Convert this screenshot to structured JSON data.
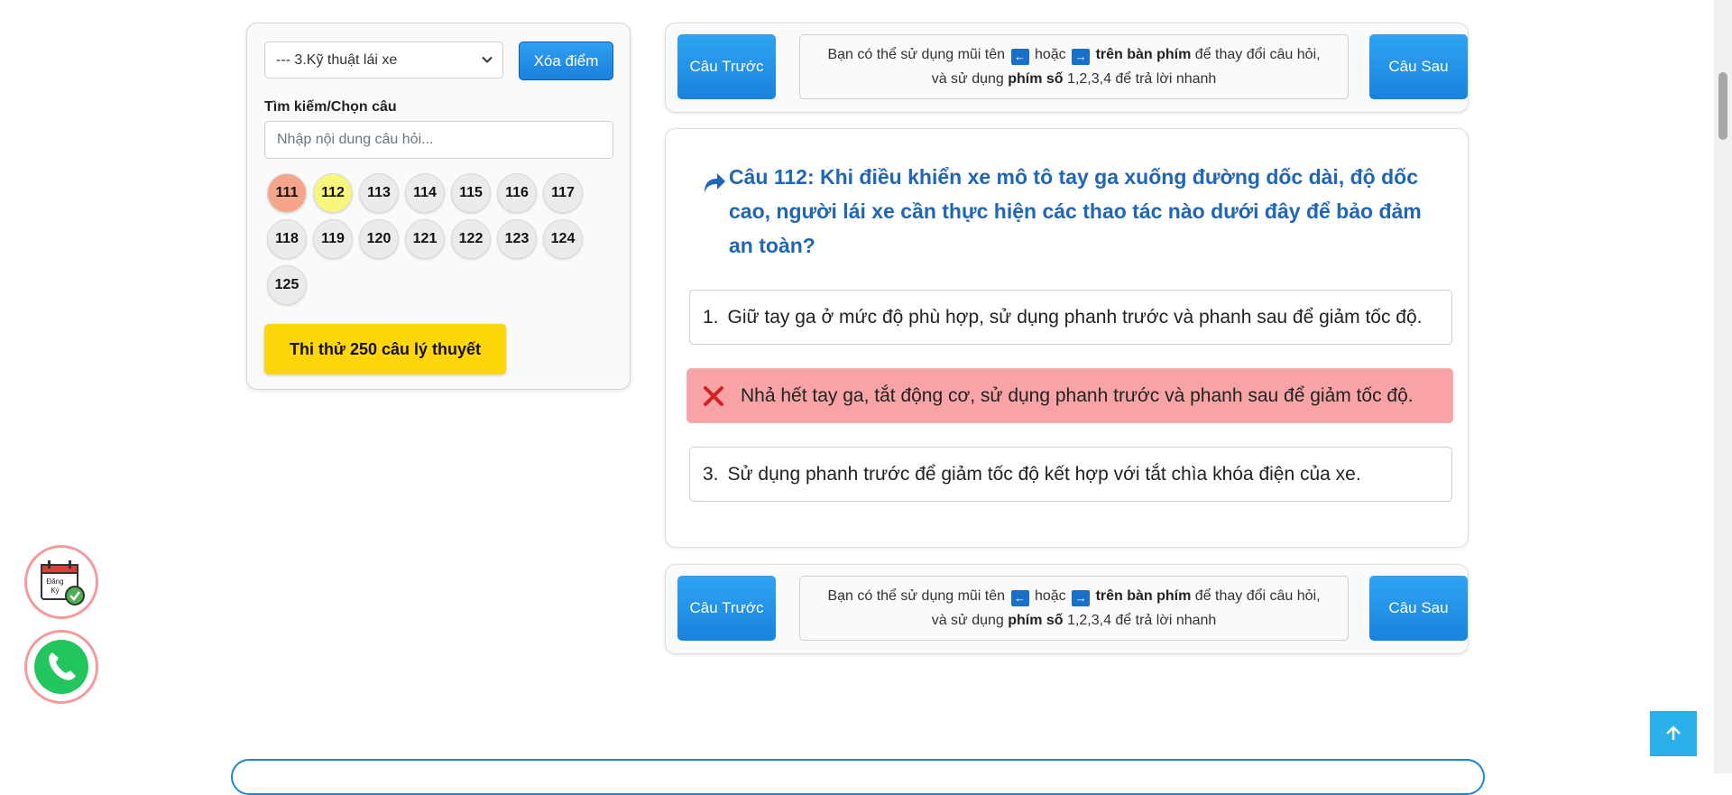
{
  "sidebar": {
    "chapter_select": "--- 3.Kỹ thuật lái xe",
    "clear_button": "Xóa điểm",
    "search_label": "Tìm kiếm/Chọn câu",
    "search_placeholder": "Nhập nội dung câu hỏi...",
    "questions": [
      {
        "n": "111",
        "state": "wrong"
      },
      {
        "n": "112",
        "state": "current"
      },
      {
        "n": "113",
        "state": "default"
      },
      {
        "n": "114",
        "state": "default"
      },
      {
        "n": "115",
        "state": "default"
      },
      {
        "n": "116",
        "state": "default"
      },
      {
        "n": "117",
        "state": "default"
      },
      {
        "n": "118",
        "state": "default"
      },
      {
        "n": "119",
        "state": "default"
      },
      {
        "n": "120",
        "state": "default"
      },
      {
        "n": "121",
        "state": "default"
      },
      {
        "n": "122",
        "state": "default"
      },
      {
        "n": "123",
        "state": "default"
      },
      {
        "n": "124",
        "state": "default"
      },
      {
        "n": "125",
        "state": "default"
      }
    ],
    "exam_button": "Thi thử 250 câu lý thuyết"
  },
  "nav": {
    "prev_label": "Câu Trước",
    "next_label": "Câu Sau",
    "hint_text1": "Bạn có thể sử dụng mũi tên",
    "left_key": "←",
    "hint_or": "hoặc",
    "right_key": "→",
    "hint_bold1": "trên bàn phím",
    "hint_text2": "để thay đổi câu hỏi, và sử dụng",
    "hint_bold2": "phím số",
    "hint_text3": "1,2,3,4 để trả lời nhanh"
  },
  "question": {
    "title": "Câu 112: Khi điều khiển xe mô tô tay ga xuống đường dốc dài, độ dốc cao, người lái xe cần thực hiện các thao tác nào dưới đây để bảo đảm an toàn?",
    "answers": [
      {
        "num": "1.",
        "text": "Giữ tay ga ở mức độ phù hợp, sử dụng phanh trước và phanh sau để giảm tốc độ.",
        "state": "normal"
      },
      {
        "num": "",
        "text": "Nhả hết tay ga, tắt động cơ, sử dụng phanh trước và phanh sau để giảm tốc độ.",
        "state": "wrong"
      },
      {
        "num": "3.",
        "text": "Sử dụng phanh trước để giảm tốc độ kết hợp với tắt chìa khóa điện của xe.",
        "state": "normal"
      }
    ]
  },
  "floating": {
    "register_label_1": "Đăng",
    "register_label_2": "Ký"
  },
  "colors": {
    "primary": "#1a80dc",
    "title": "#1f66b5",
    "wrong_bg": "#f8a3a6",
    "current_q": "#f8f67c",
    "wrong_q": "#f5a68a",
    "exam_btn": "#ffd60a"
  }
}
